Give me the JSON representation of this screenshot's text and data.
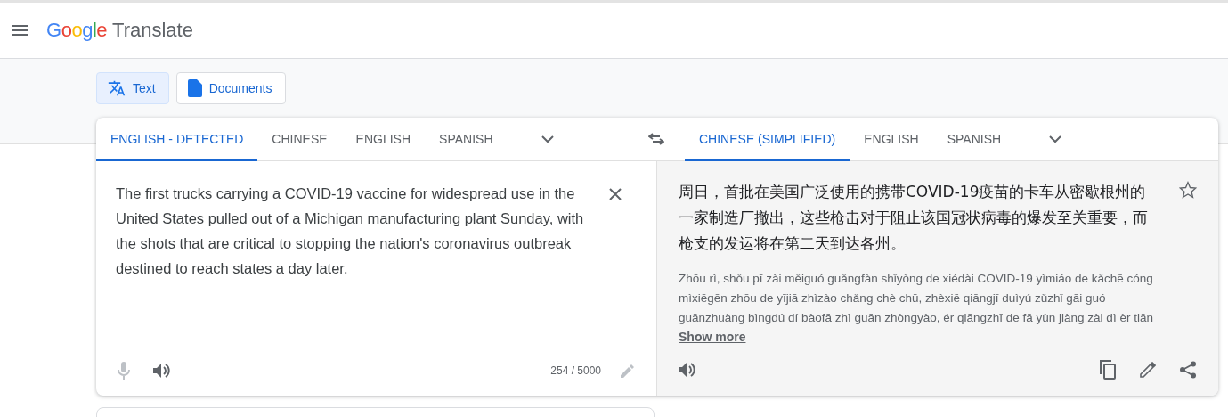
{
  "header": {
    "logo_brand": "Google",
    "logo_product": "Translate"
  },
  "mode_buttons": [
    {
      "label": "Text",
      "kind": "text",
      "selected": true
    },
    {
      "label": "Documents",
      "kind": "document",
      "selected": false
    }
  ],
  "source": {
    "tabs": [
      {
        "label": "ENGLISH - DETECTED",
        "selected": true
      },
      {
        "label": "CHINESE",
        "selected": false
      },
      {
        "label": "ENGLISH",
        "selected": false
      },
      {
        "label": "SPANISH",
        "selected": false
      }
    ],
    "text": "The first trucks carrying a COVID-19 vaccine for widespread use in the United States pulled out of a Michigan manufacturing plant Sunday, with the shots that are critical to stopping the nation's coronavirus outbreak destined to reach states a day later.",
    "char_count": "254 / 5000"
  },
  "target": {
    "tabs": [
      {
        "label": "CHINESE (SIMPLIFIED)",
        "selected": true
      },
      {
        "label": "ENGLISH",
        "selected": false
      },
      {
        "label": "SPANISH",
        "selected": false
      }
    ],
    "translation_lines": [
      "周日，首批在美国广泛使用的携带COVID-19疫苗的卡车从密歇根州的",
      "一家制造厂撤出，这些枪击对于阻止该国冠状病毒的爆发至关重要，而",
      "枪支的发运将在第二天到达各州。"
    ],
    "romanization_lines": [
      "Zhōu rì, shǒu pī zài měiguó guǎngfàn shǐyòng de xiédài COVID-19 yìmiáo de kǎchē cóng",
      "mìxiēgēn zhōu de yījiā zhìzào chǎng chè chū, zhèxiē qiāngjī duìyú zǔzhǐ gāi guó",
      "guānzhuàng bìngdú dí bàofā zhì guān zhòngyào, ér qiāngzhī de fā yùn jiàng zài dì èr tiān"
    ],
    "show_more": "Show more",
    "starred": false
  }
}
